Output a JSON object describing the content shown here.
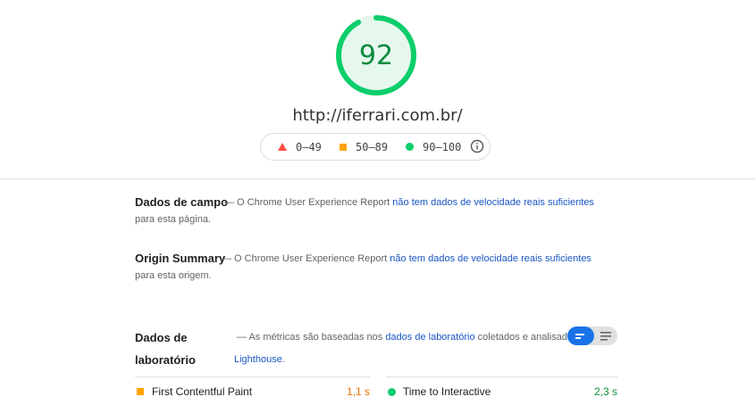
{
  "score": {
    "value": "92",
    "fraction": 0.92,
    "color": "#0cce6b"
  },
  "url": "http://iferrari.com.br/",
  "legend": {
    "bad": "0–49",
    "average": "50–89",
    "good": "90–100"
  },
  "field_data": {
    "title": "Dados de campo",
    "dash_text": "— O Chrome User Experience Report",
    "link_text": "não tem dados de velocidade reais suficientes",
    "tail": "para esta página."
  },
  "origin_summary": {
    "title": "Origin Summary",
    "dash_text": "— O Chrome User Experience Report",
    "link_text": "não tem dados de velocidade reais suficientes",
    "tail": "para esta origem."
  },
  "lab_data": {
    "title_line1": "Dados de",
    "title_line2": "laboratório",
    "dash_text": "— As métricas são baseadas nos",
    "link_text": "dados de laboratório",
    "mid_text": "coletados e analisados",
    "link2_text": "Lighthouse",
    "end_text": "."
  },
  "metrics": [
    {
      "name": "First Contentful Paint",
      "value": "1,1 s",
      "status": "average",
      "color": "#e67700"
    },
    {
      "name": "Time to Interactive",
      "value": "2,3 s",
      "status": "good",
      "color": "#0b8a3c"
    }
  ]
}
